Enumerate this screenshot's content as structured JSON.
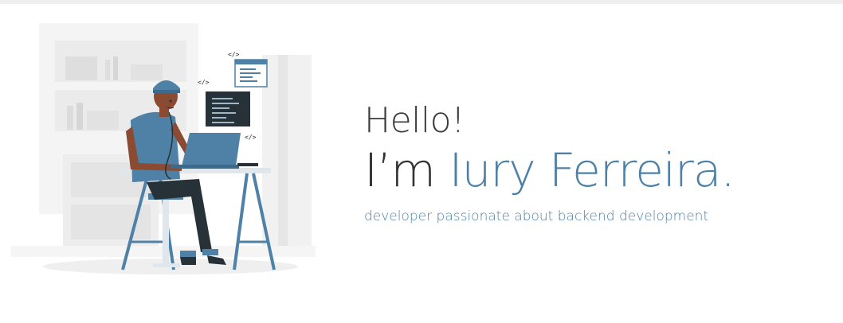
{
  "hero": {
    "greeting": "Hello!",
    "intro_prefix": "I’m ",
    "name": "Iury Ferreira.",
    "tagline": "developer passionate about backend development"
  },
  "illustration": {
    "code_tag": "</>"
  },
  "colors": {
    "accent": "#4f81a6",
    "text_dark": "#333333",
    "bg_top_bar": "#efefef"
  }
}
